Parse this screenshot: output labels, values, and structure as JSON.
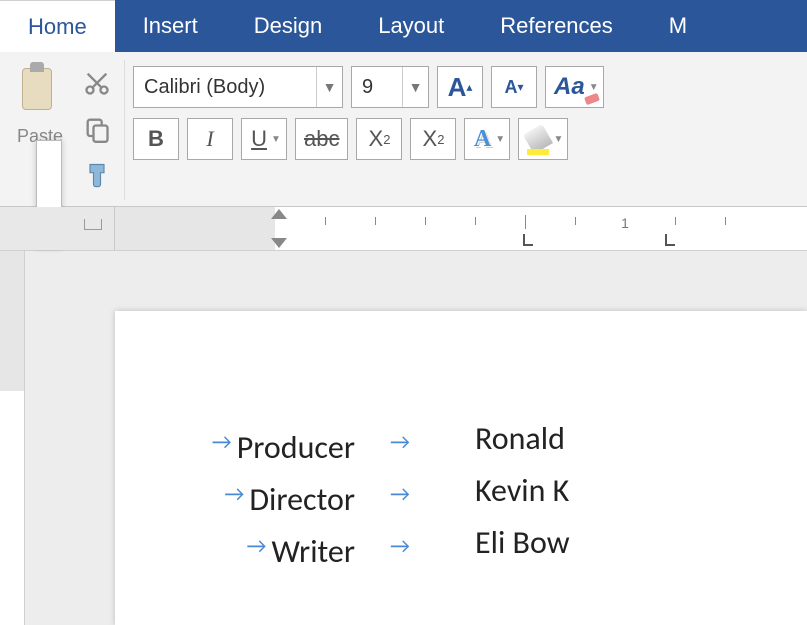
{
  "tabs": {
    "home": "Home",
    "insert": "Insert",
    "design": "Design",
    "layout": "Layout",
    "references": "References",
    "partial": "M"
  },
  "clipboard": {
    "paste_label": "Paste"
  },
  "font": {
    "name": "Calibri (Body)",
    "size": "9",
    "grow": "A",
    "shrink": "A",
    "clear": "Aa",
    "bold": "B",
    "italic": "I",
    "underline": "U",
    "strike": "abc",
    "subscript_base": "X",
    "subscript_sub": "2",
    "superscript_base": "X",
    "superscript_sup": "2",
    "effects": "A"
  },
  "ruler": {
    "num1": "1"
  },
  "document": {
    "lines": [
      {
        "role": "Producer",
        "name": "Ronald"
      },
      {
        "role": "Director",
        "name": "Kevin K"
      },
      {
        "role": "Writer",
        "name": "Eli Bow"
      }
    ]
  }
}
